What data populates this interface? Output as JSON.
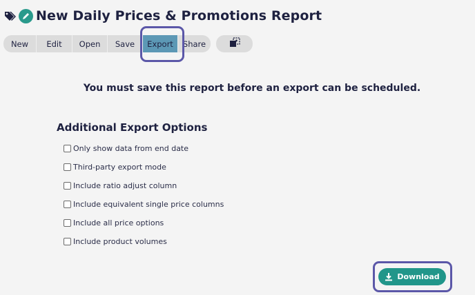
{
  "header": {
    "title": "New Daily Prices & Promotions Report",
    "icons": [
      "tag-icon",
      "pencil-icon"
    ]
  },
  "toolbar": {
    "buttons": [
      {
        "label": "New"
      },
      {
        "label": "Edit"
      },
      {
        "label": "Open"
      },
      {
        "label": "Save"
      },
      {
        "label": "Export",
        "active": true
      },
      {
        "label": "Share"
      }
    ],
    "extra_icon": "copy-icon"
  },
  "notice": "You must save this report before an export can be scheduled.",
  "export_options": {
    "title": "Additional Export Options",
    "options": [
      {
        "label": "Only show data from end date",
        "checked": false
      },
      {
        "label": "Third-party export mode",
        "checked": false
      },
      {
        "label": "Include ratio adjust column",
        "checked": false
      },
      {
        "label": "Include equivalent single price columns",
        "checked": false
      },
      {
        "label": "Include all price options",
        "checked": false
      },
      {
        "label": "Include product volumes",
        "checked": false
      }
    ]
  },
  "download": {
    "label": "Download",
    "icon": "download-icon"
  },
  "colors": {
    "accent": "#21968a",
    "active_tab": "#5c98b5",
    "highlight": "#5b57a8",
    "text": "#1e2140"
  }
}
